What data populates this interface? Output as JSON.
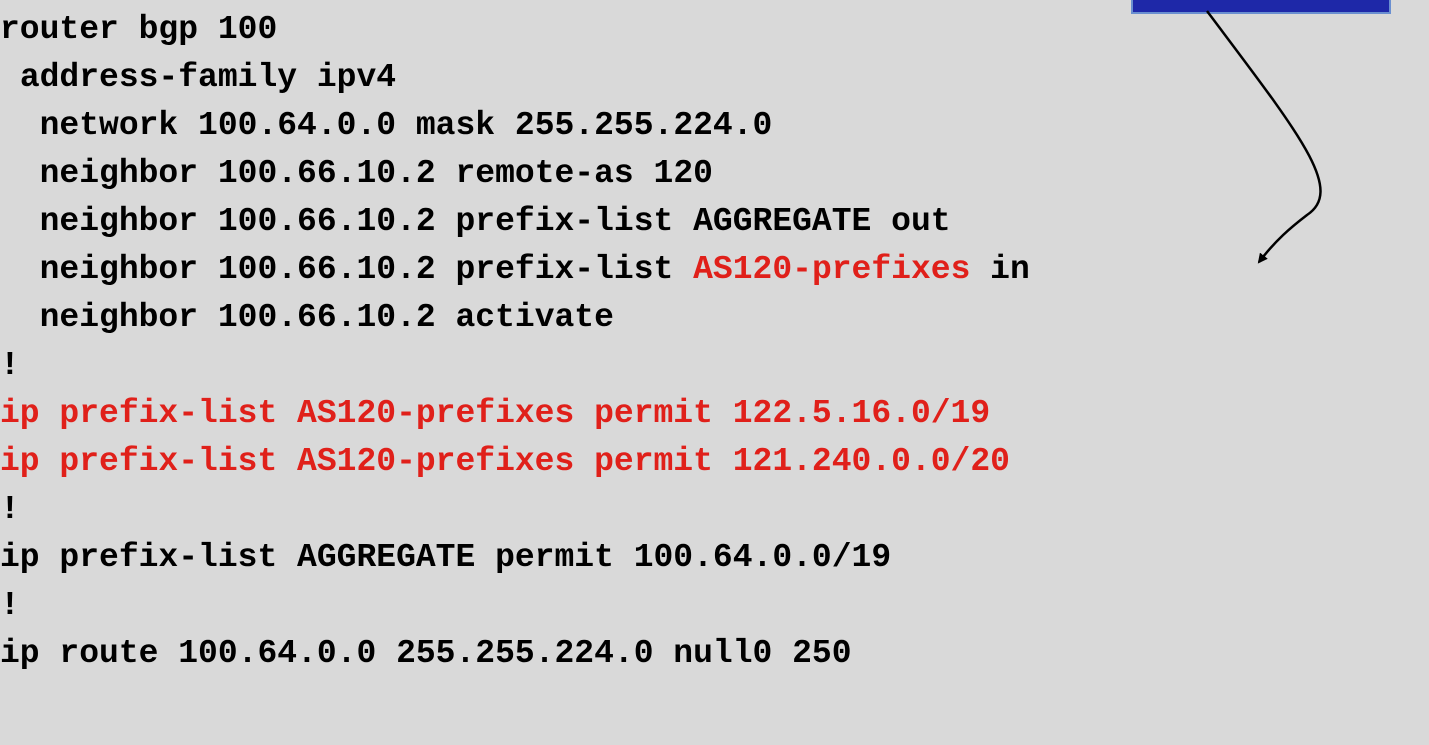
{
  "colors": {
    "background": "#d9d9d9",
    "text": "#000000",
    "highlight": "#e0201a",
    "callout_fill": "#1e28a8",
    "callout_border": "#6a8fd0"
  },
  "config": {
    "lines": [
      {
        "indent": "",
        "text": "router bgp 100"
      },
      {
        "indent": " ",
        "text": "address-family ipv4"
      },
      {
        "indent": "  ",
        "text": "network 100.64.0.0 mask 255.255.224.0"
      },
      {
        "indent": "  ",
        "text": "neighbor 100.66.10.2 remote-as 120"
      },
      {
        "indent": "  ",
        "text": "neighbor 100.66.10.2 prefix-list AGGREGATE out"
      },
      {
        "indent": "  ",
        "pre": "neighbor 100.66.10.2 prefix-list ",
        "hl": "AS120-prefixes",
        "post": " in"
      },
      {
        "indent": "  ",
        "text": "neighbor 100.66.10.2 activate"
      },
      {
        "indent": "",
        "text": "!"
      },
      {
        "indent": "",
        "text": "ip prefix-list AS120-prefixes permit 122.5.16.0/19"
      },
      {
        "indent": "",
        "text": "ip prefix-list AS120-prefixes permit 121.240.0.0/20"
      },
      {
        "indent": "",
        "text": "!"
      },
      {
        "indent": "",
        "text": "ip prefix-list AGGREGATE permit 100.64.0.0/19"
      },
      {
        "indent": "",
        "text": "!"
      },
      {
        "indent": "",
        "text": "ip route 100.64.0.0 255.255.224.0 null0 250"
      }
    ]
  }
}
